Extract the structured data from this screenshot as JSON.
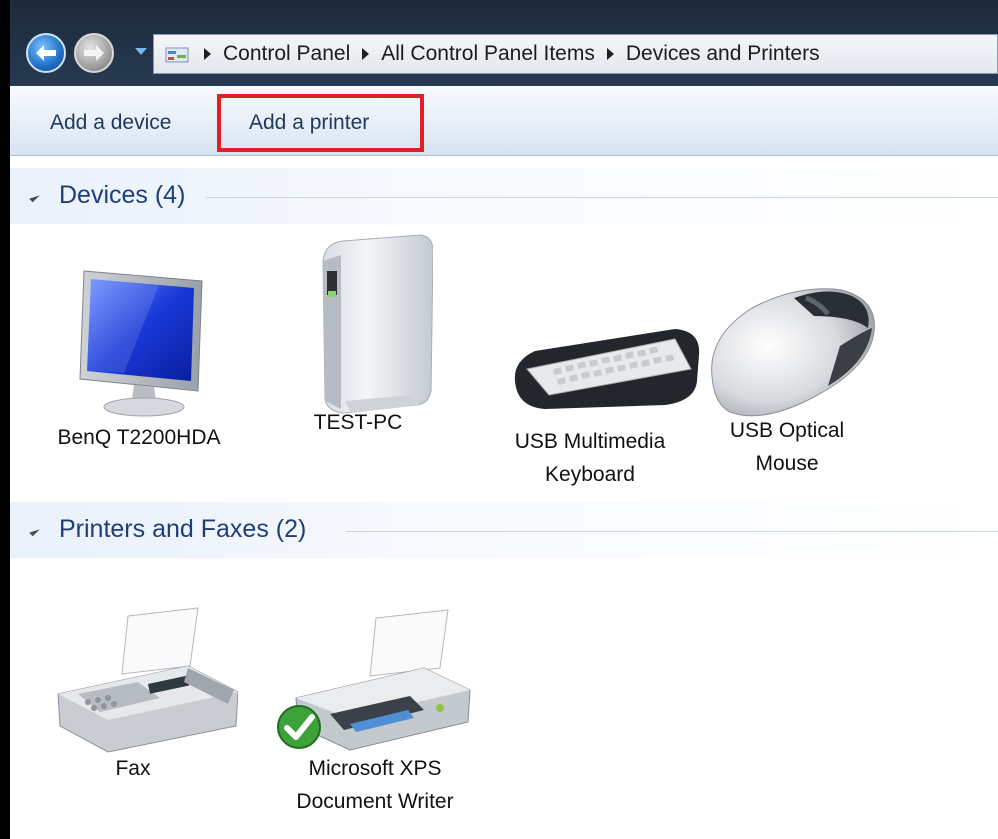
{
  "breadcrumb": {
    "items": [
      "Control Panel",
      "All Control Panel Items",
      "Devices and Printers"
    ]
  },
  "commandbar": {
    "add_device": "Add a device",
    "add_printer": "Add a printer",
    "highlight_color": "#e31e24"
  },
  "groups": {
    "devices": {
      "title": "Devices (4)",
      "items": [
        {
          "line1": "BenQ T2200HDA",
          "line2": "",
          "icon": "monitor-icon"
        },
        {
          "line1": "TEST-PC",
          "line2": "",
          "icon": "computer-tower-icon"
        },
        {
          "line1": "USB Multimedia",
          "line2": "Keyboard",
          "icon": "keyboard-icon"
        },
        {
          "line1": "USB Optical",
          "line2": "Mouse",
          "icon": "mouse-icon"
        }
      ]
    },
    "printers": {
      "title": "Printers and Faxes (2)",
      "items": [
        {
          "line1": "Fax",
          "line2": "",
          "icon": "fax-icon"
        },
        {
          "line1": "Microsoft XPS",
          "line2": "Document Writer",
          "icon": "printer-icon",
          "badge": "default-check-icon"
        }
      ]
    }
  },
  "colors": {
    "header_text": "#1e3e7a",
    "command_text": "#1e395b"
  }
}
